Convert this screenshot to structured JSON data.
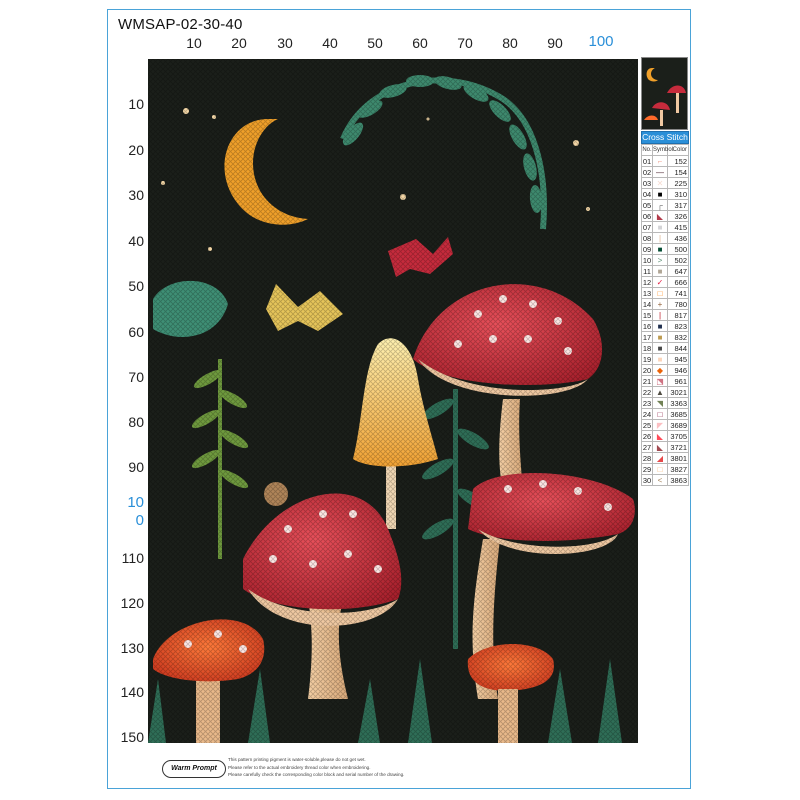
{
  "pattern_code": "WMSAP-02-30-40",
  "ruler_top": [
    "10",
    "20",
    "30",
    "40",
    "50",
    "60",
    "70",
    "80",
    "90",
    "100"
  ],
  "ruler_left": [
    "10",
    "20",
    "30",
    "40",
    "50",
    "60",
    "70",
    "80",
    "90",
    "10\n0",
    "110",
    "120",
    "130",
    "140",
    "150"
  ],
  "legend": {
    "title": "Cross Stitch",
    "col_no": "No.",
    "col_symbol": "Symbol",
    "col_color": "Color",
    "rows": [
      {
        "no": "01",
        "symbol": "⌐",
        "color": "152",
        "swatch": "#f4b7a8"
      },
      {
        "no": "02",
        "symbol": "—",
        "color": "154",
        "swatch": "#4a1e2a"
      },
      {
        "no": "03",
        "symbol": "✕",
        "color": "225",
        "swatch": "#f6dcd2"
      },
      {
        "no": "04",
        "symbol": "■",
        "color": "310",
        "swatch": "#000000"
      },
      {
        "no": "05",
        "symbol": "┌",
        "color": "317",
        "swatch": "#6c6c6c"
      },
      {
        "no": "06",
        "symbol": "◣",
        "color": "326",
        "swatch": "#b33b4b"
      },
      {
        "no": "07",
        "symbol": "■",
        "color": "415",
        "swatch": "#d3d3d6"
      },
      {
        "no": "08",
        "symbol": "|",
        "color": "436",
        "swatch": "#dcb48c"
      },
      {
        "no": "09",
        "symbol": "■",
        "color": "500",
        "swatch": "#044d33"
      },
      {
        "no": "10",
        "symbol": ">",
        "color": "502",
        "swatch": "#5b9073"
      },
      {
        "no": "11",
        "symbol": "■",
        "color": "647",
        "swatch": "#b0a696"
      },
      {
        "no": "12",
        "symbol": "✓",
        "color": "666",
        "swatch": "#e31d42"
      },
      {
        "no": "13",
        "symbol": "□",
        "color": "741",
        "swatch": "#ff8c1a"
      },
      {
        "no": "14",
        "symbol": "+",
        "color": "780",
        "swatch": "#94633a"
      },
      {
        "no": "15",
        "symbol": "|",
        "color": "817",
        "swatch": "#bb0f1e"
      },
      {
        "no": "16",
        "symbol": "■",
        "color": "823",
        "swatch": "#21304f"
      },
      {
        "no": "17",
        "symbol": "■",
        "color": "832",
        "swatch": "#bd9b51"
      },
      {
        "no": "18",
        "symbol": "■",
        "color": "844",
        "swatch": "#484848"
      },
      {
        "no": "19",
        "symbol": "■",
        "color": "945",
        "swatch": "#fbd5bb"
      },
      {
        "no": "20",
        "symbol": "◆",
        "color": "946",
        "swatch": "#eb6307"
      },
      {
        "no": "21",
        "symbol": "⬔",
        "color": "961",
        "swatch": "#cf7383"
      },
      {
        "no": "22",
        "symbol": "▲",
        "color": "3021",
        "swatch": "#4f4b41"
      },
      {
        "no": "23",
        "symbol": "◥",
        "color": "3363",
        "swatch": "#728256"
      },
      {
        "no": "24",
        "symbol": "□",
        "color": "3685",
        "swatch": "#88153d"
      },
      {
        "no": "25",
        "symbol": "◤",
        "color": "3689",
        "swatch": "#fbbfc2"
      },
      {
        "no": "26",
        "symbol": "◣",
        "color": "3705",
        "swatch": "#ff4b59"
      },
      {
        "no": "27",
        "symbol": "◣",
        "color": "3721",
        "swatch": "#a14b51"
      },
      {
        "no": "28",
        "symbol": "◢",
        "color": "3801",
        "swatch": "#e7494a"
      },
      {
        "no": "29",
        "symbol": "□",
        "color": "3827",
        "swatch": "#f7b978"
      },
      {
        "no": "30",
        "symbol": "<",
        "color": "3863",
        "swatch": "#a4835c"
      }
    ]
  },
  "footer": {
    "badge": "Warm Prompt",
    "notes": [
      "This pattern printing pigment is water-soluble,please do not get wet.",
      "Please refer to the actual embroidery thread color when embroidering.",
      "Please carefully check the corresponding color block and serial number of the drawing."
    ]
  },
  "colors": {
    "border": "#4aa3d8",
    "ruler_accent": "#2a8fd8",
    "background": "#1b1f1a"
  }
}
